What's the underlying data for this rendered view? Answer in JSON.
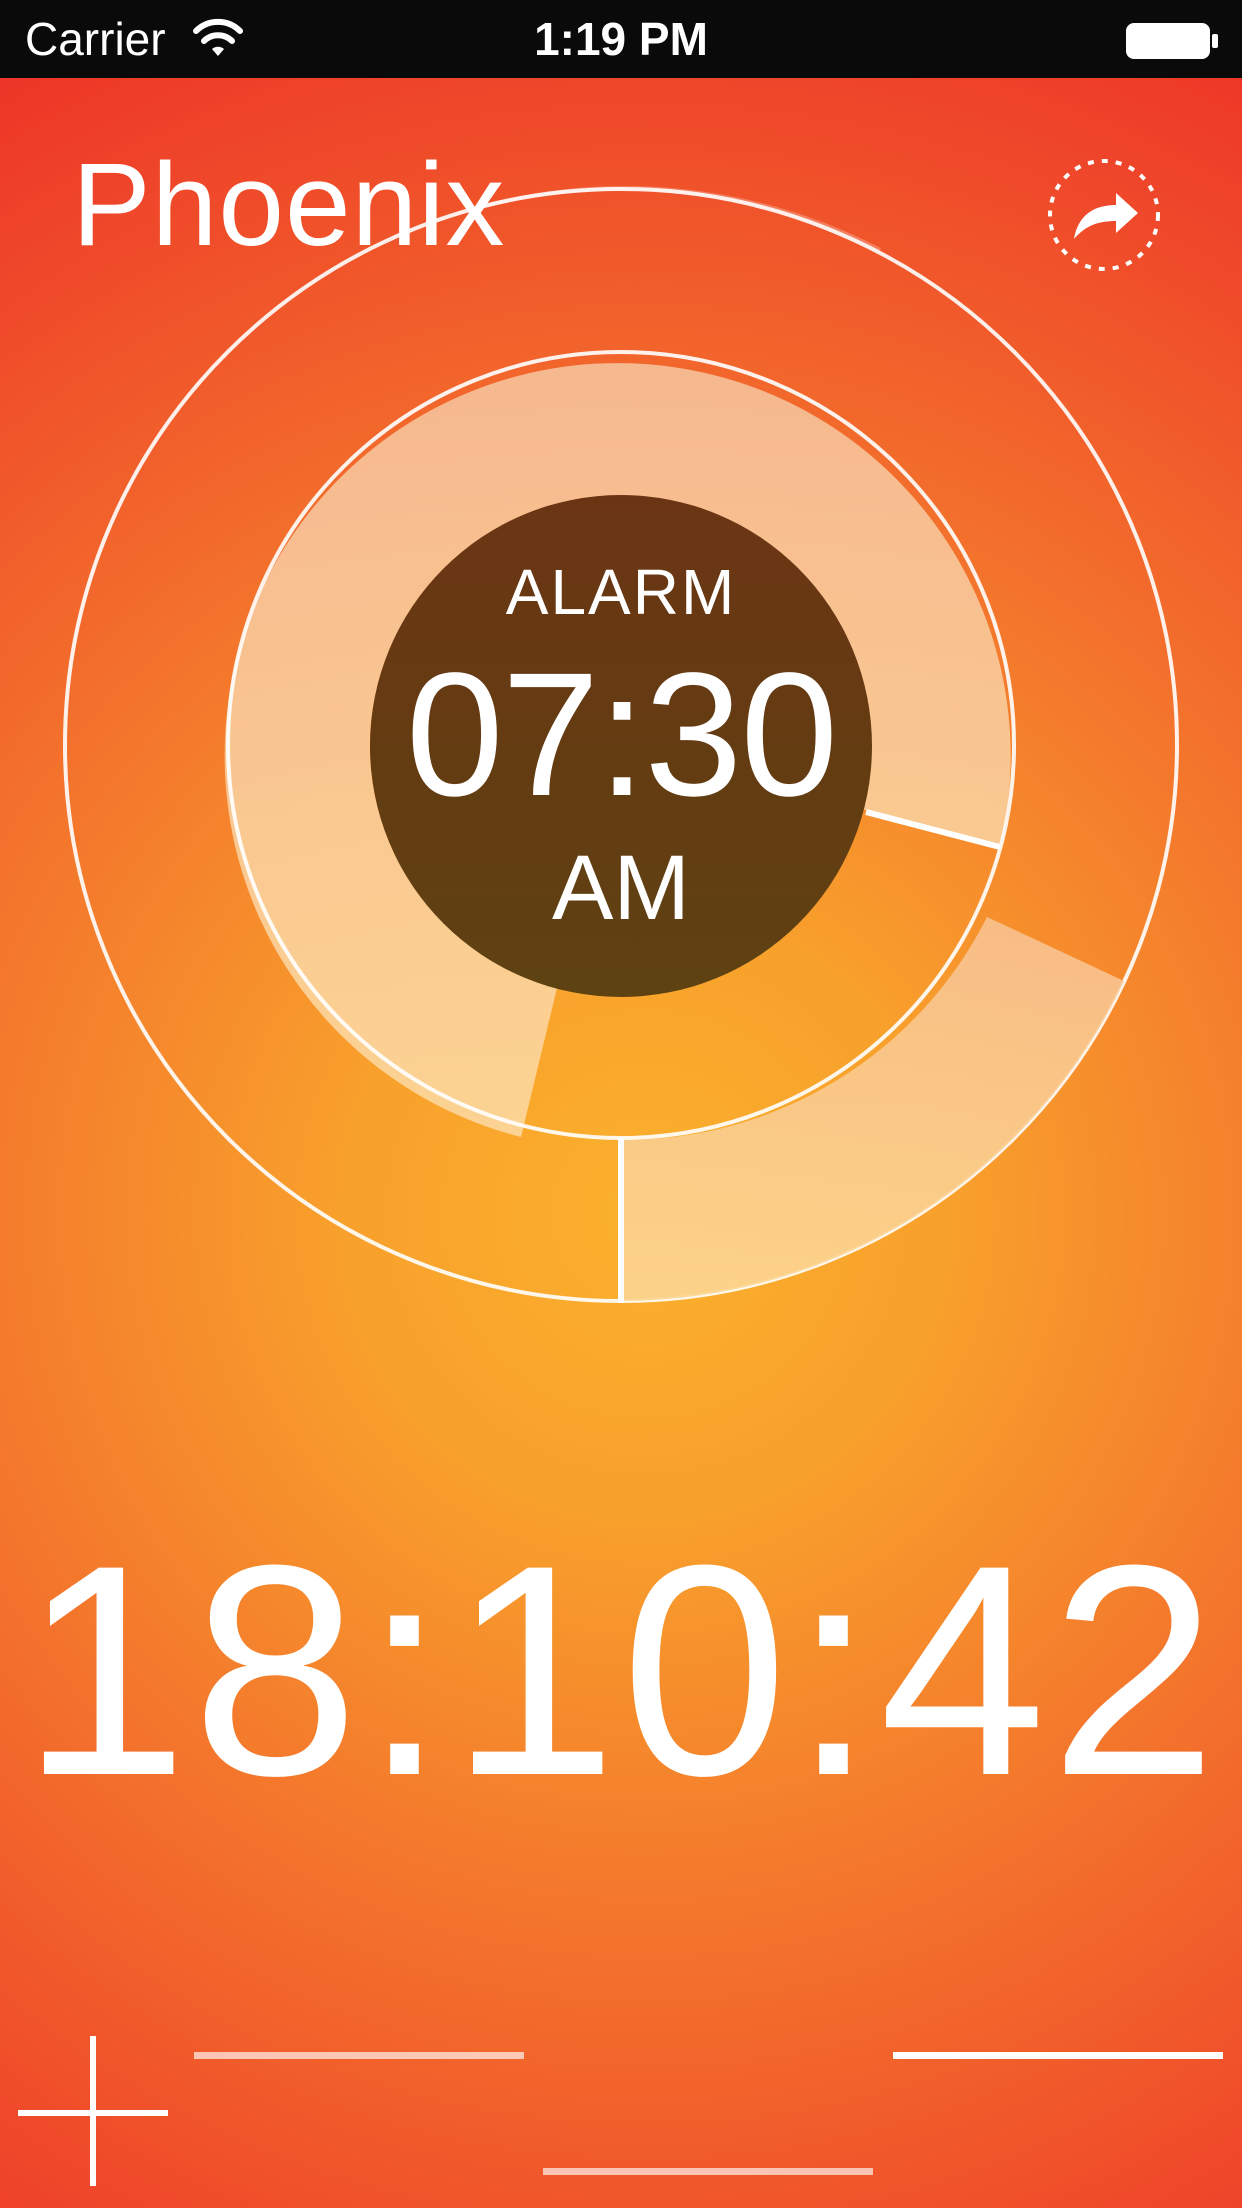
{
  "status_bar": {
    "carrier": "Carrier",
    "time": "1:19 PM",
    "wifi_icon": "wifi-icon",
    "battery_icon": "battery-full-icon"
  },
  "header": {
    "title": "Phoenix",
    "share_icon": "share-arrow-icon"
  },
  "alarm": {
    "label": "ALARM",
    "time": "07:30",
    "period": "AM"
  },
  "current_time": "18:10:42",
  "controls": {
    "add_icon": "plus-icon",
    "pages": 3,
    "active_page": 3
  },
  "colors": {
    "background_center": "#fbb12c",
    "background_edge": "#ec2f27",
    "alarm_disc": "#5e3a12",
    "text": "#ffffff"
  }
}
